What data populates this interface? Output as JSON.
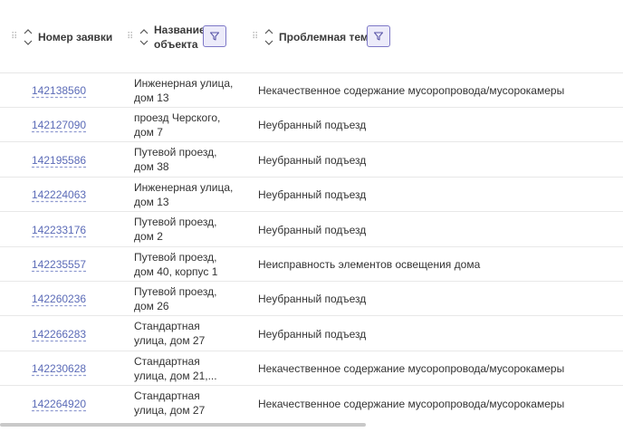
{
  "columns": {
    "request_number": {
      "label": "Номер заявки"
    },
    "object_name": {
      "label_line1": "Название",
      "label_line2": "объекта"
    },
    "problem_topic": {
      "label": "Проблемная тема"
    }
  },
  "icons": {
    "drag": "drag-handle-icon",
    "sort": "sort-arrows-icon",
    "filter": "filter-funnel-icon"
  },
  "colors": {
    "link": "#5b6bb7",
    "filter_border": "#7d78c7",
    "filter_bg": "#ecebfa"
  },
  "rows": [
    {
      "id": "142138560",
      "object": "Инженерная улица,\nдом 13",
      "topic": "Некачественное содержание мусоропровода/мусорокамеры"
    },
    {
      "id": "142127090",
      "object": "проезд Черского,\nдом 7",
      "topic": "Неубранный подъезд"
    },
    {
      "id": "142195586",
      "object": "Путевой проезд,\nдом 38",
      "topic": "Неубранный подъезд"
    },
    {
      "id": "142224063",
      "object": "Инженерная улица,\nдом 13",
      "topic": "Неубранный подъезд"
    },
    {
      "id": "142233176",
      "object": "Путевой проезд,\nдом 2",
      "topic": "Неубранный подъезд"
    },
    {
      "id": "142235557",
      "object": "Путевой проезд,\nдом 40, корпус 1",
      "topic": "Неисправность элементов освещения дома"
    },
    {
      "id": "142260236",
      "object": "Путевой проезд,\nдом 26",
      "topic": "Неубранный подъезд"
    },
    {
      "id": "142266283",
      "object": "Стандартная\nулица, дом 27",
      "topic": "Неубранный подъезд"
    },
    {
      "id": "142230628",
      "object": "Стандартная\nулица, дом 21,...",
      "topic": "Некачественное содержание мусоропровода/мусорокамеры"
    },
    {
      "id": "142264920",
      "object": "Стандартная\nулица, дом 27",
      "topic": "Некачественное содержание мусоропровода/мусорокамеры"
    }
  ]
}
